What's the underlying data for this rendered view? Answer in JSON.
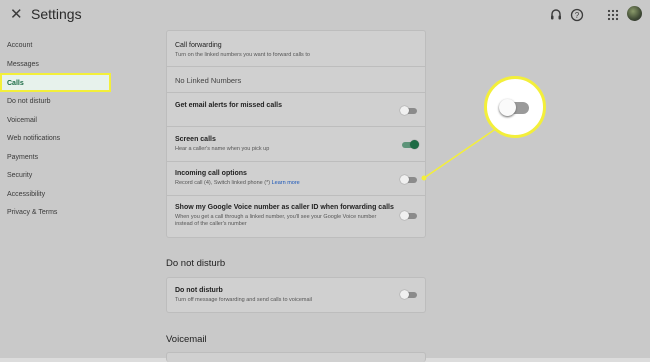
{
  "header": {
    "title": "Settings"
  },
  "sidebar": {
    "items": [
      {
        "label": "Account"
      },
      {
        "label": "Messages"
      },
      {
        "label": "Calls"
      },
      {
        "label": "Do not disturb"
      },
      {
        "label": "Voicemail"
      },
      {
        "label": "Web notifications"
      },
      {
        "label": "Payments"
      },
      {
        "label": "Security"
      },
      {
        "label": "Accessibility"
      },
      {
        "label": "Privacy & Terms"
      }
    ],
    "active": "Calls"
  },
  "calls": {
    "call_forwarding": {
      "title": "Call forwarding",
      "subtitle": "Turn on the linked numbers you want to forward calls to",
      "empty": "No Linked Numbers"
    },
    "email_alerts": {
      "title": "Get email alerts for missed calls",
      "state": "off"
    },
    "screen_calls": {
      "title": "Screen calls",
      "subtitle": "Hear a caller's name when you pick up",
      "state": "on"
    },
    "incoming": {
      "title": "Incoming call options",
      "subtitle": "Record call (4), Switch linked phone (*)",
      "link": "Learn more",
      "state": "off"
    },
    "caller_id": {
      "title": "Show my Google Voice number as caller ID when forwarding calls",
      "subtitle1": "When you get a call through a linked number, you'll see your Google Voice number",
      "subtitle2": "instead of the caller's number",
      "state": "off"
    }
  },
  "dnd": {
    "section": "Do not disturb",
    "title": "Do not disturb",
    "subtitle": "Turn off message forwarding and send calls to voicemail",
    "state": "off"
  },
  "voicemail": {
    "section": "Voicemail"
  },
  "colors": {
    "highlight": "#f3ef3a",
    "accent": "#1e6b45",
    "active_bg": "#e7f2ec"
  }
}
